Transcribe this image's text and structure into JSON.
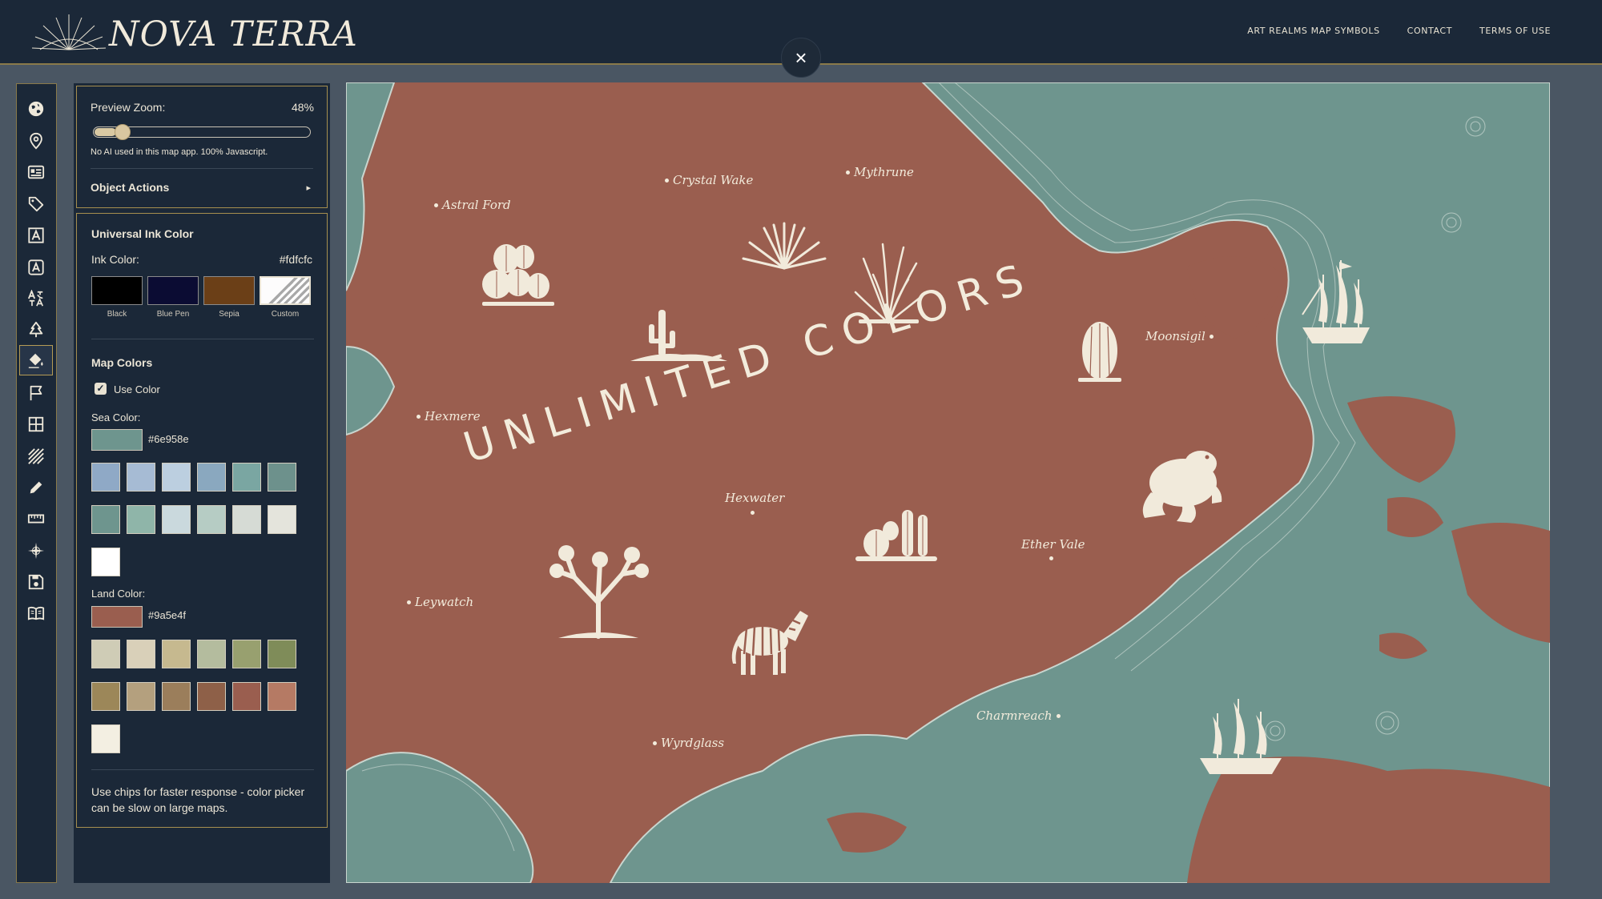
{
  "app": {
    "name": "NOVA TERRA"
  },
  "nav": [
    "ART REALMS MAP SYMBOLS",
    "CONTACT",
    "TERMS OF USE"
  ],
  "close_icon": "×",
  "toolbar_icons": [
    "globe-icon",
    "pin-icon",
    "newspaper-icon",
    "tag-icon",
    "text-icon",
    "text-box-icon",
    "translate-icon",
    "tree-icon",
    "paint-bucket-icon",
    "flag-icon",
    "grid-icon",
    "hatch-icon",
    "pencil-icon",
    "ruler-icon",
    "compass-icon",
    "save-icon",
    "book-icon"
  ],
  "active_tool": "paint-bucket-icon",
  "preview": {
    "zoom_label": "Preview Zoom:",
    "zoom_value": "48%",
    "zoom_fraction": 0.1,
    "note": "No AI used in this map app. 100% Javascript.",
    "object_actions": "Object Actions",
    "object_actions_arrow": "▸"
  },
  "ink": {
    "heading": "Universal Ink Color",
    "label": "Ink Color:",
    "value": "#fdfcfc",
    "options": [
      {
        "name": "Black",
        "color": "#000000"
      },
      {
        "name": "Blue Pen",
        "color": "#0b0c33"
      },
      {
        "name": "Sepia",
        "color": "#6b3f17"
      },
      {
        "name": "Custom",
        "color": "#fdfcfc"
      }
    ]
  },
  "map_colors": {
    "heading": "Map Colors",
    "use_color_label": "Use Color",
    "use_color": true,
    "sea_label": "Sea Color:",
    "sea_value": "#6e958e",
    "sea_chips": [
      "#8fa9c6",
      "#a6bbd4",
      "#bccfe0",
      "#8aa8bf",
      "#7aa6a2",
      "#6d918c",
      "#6e958e",
      "#8fb5a9",
      "#cad9dd",
      "#b6ccc4",
      "#d6dbd5",
      "#e4e4dc",
      "#ffffff"
    ],
    "land_label": "Land Color:",
    "land_value": "#9a5e4f",
    "land_chips": [
      "#cfccb6",
      "#d9d0b9",
      "#c6b98f",
      "#b4bc9e",
      "#98a06f",
      "#7f8c59",
      "#9c8759",
      "#b4a07e",
      "#9b7e5b",
      "#8e6048",
      "#9a5e4f",
      "#b57a64",
      "#f3efe2"
    ],
    "tip": "Use chips for faster response - color picker can be slow on large maps."
  },
  "map": {
    "title": "UNLIMITED COLORS",
    "sea_color": "#6e958e",
    "land_color": "#9a5e4f",
    "ink_color": "#fdfcfc",
    "places": [
      "Crystal Wake",
      "Mythrune",
      "Astral Ford",
      "Moonsigil",
      "Hexmere",
      "Hexwater",
      "Ether Vale",
      "Leywatch",
      "Charmreach",
      "Wyrdglass"
    ],
    "symbols": [
      "cactus-cluster-icon",
      "agave-icon",
      "grass-tuft-icon",
      "saguaro-icon",
      "barrel-cactus-icon",
      "frog-icon",
      "joshua-tree-icon",
      "zebra-icon",
      "cactus-pair-icon",
      "sailing-ship-icon",
      "sailing-ship-icon"
    ]
  }
}
